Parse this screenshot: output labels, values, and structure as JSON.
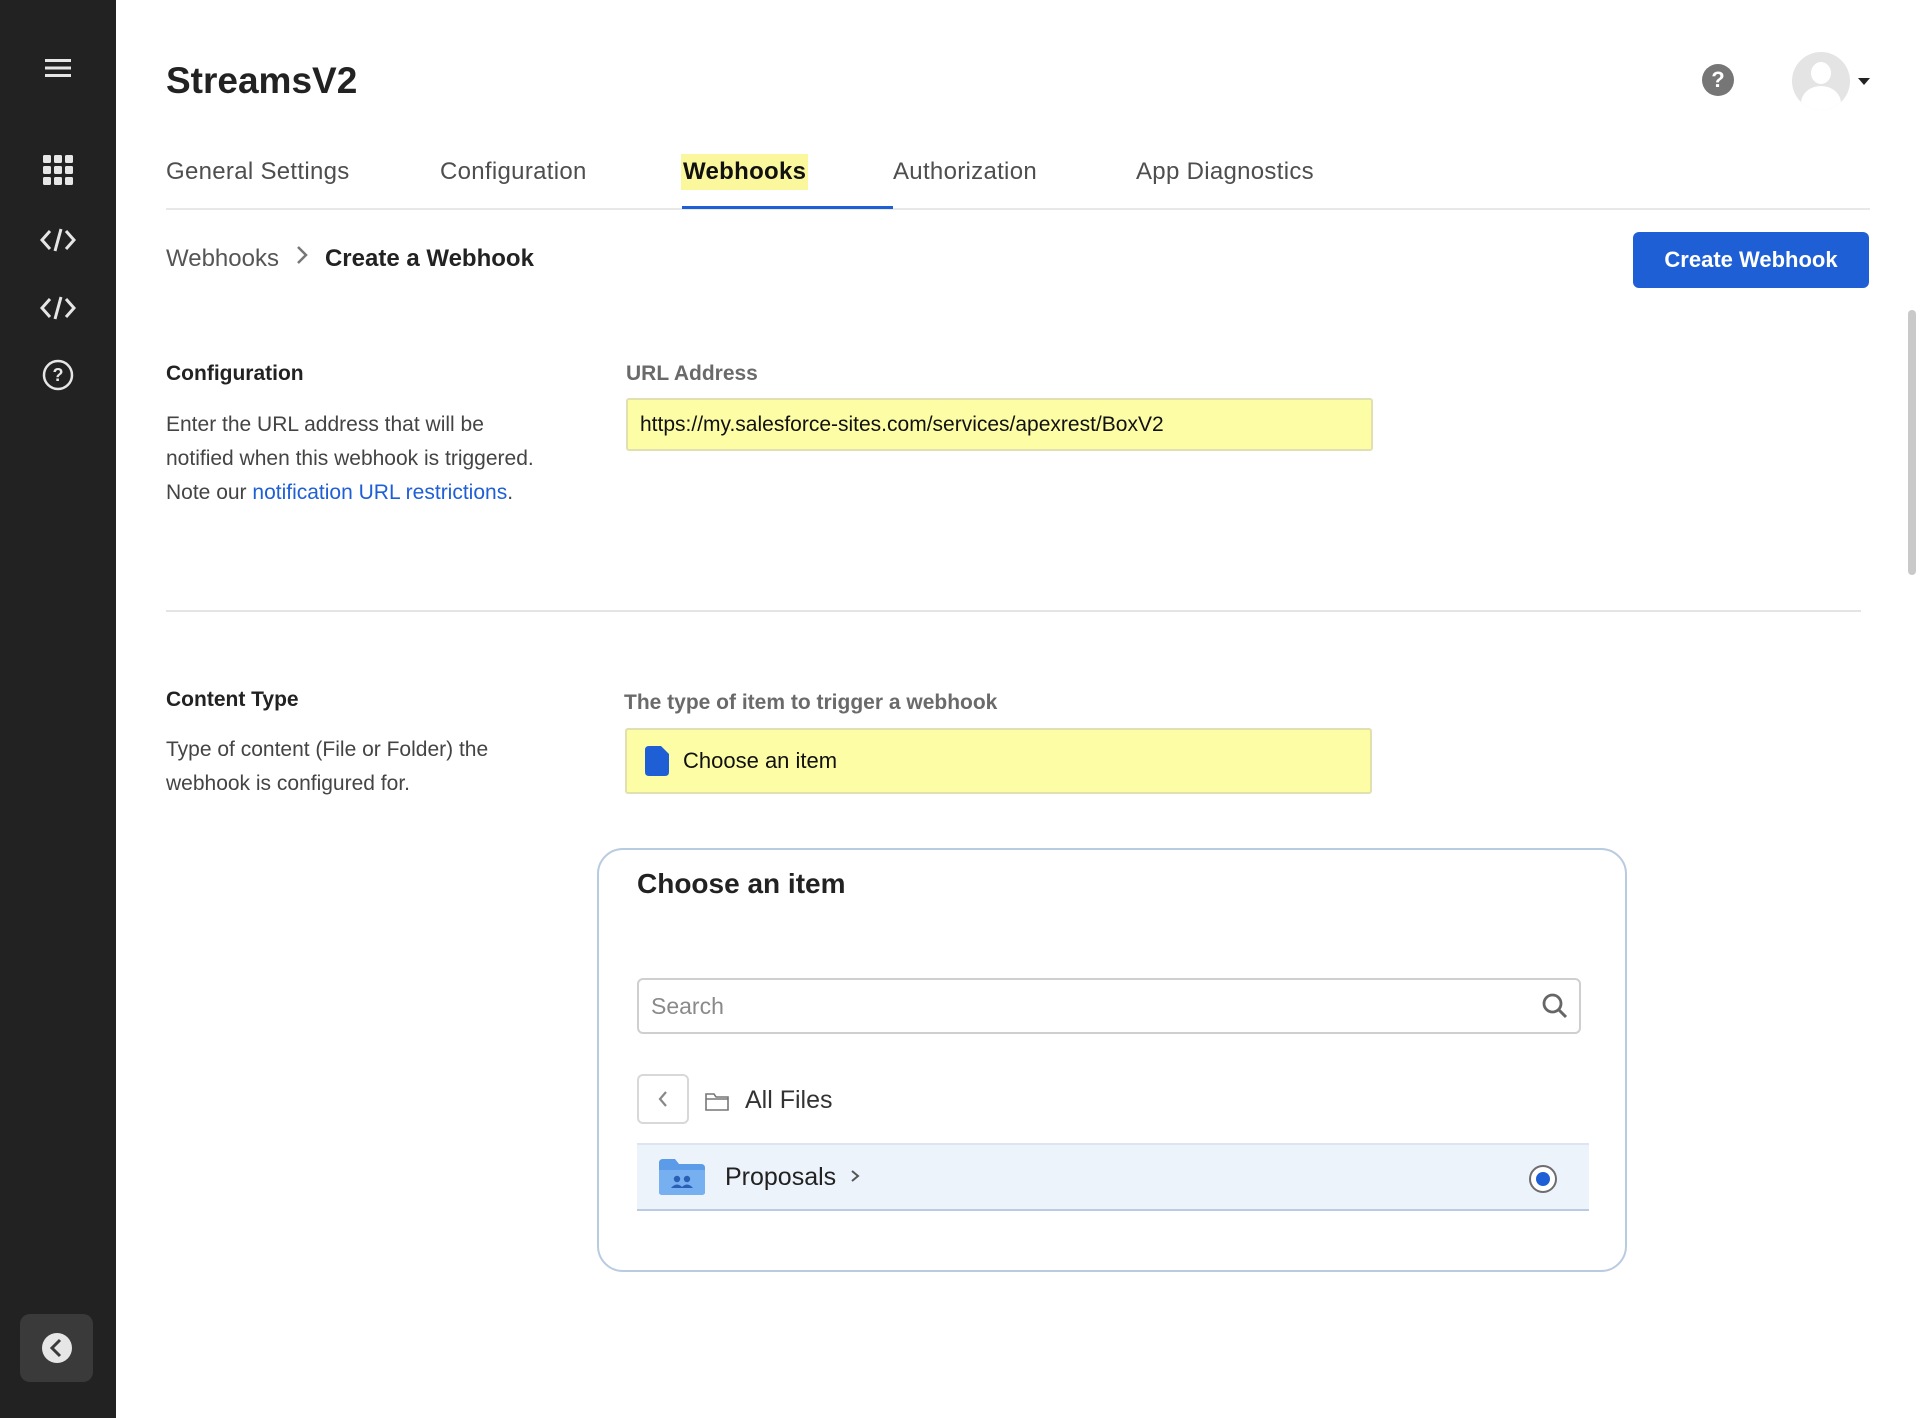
{
  "app": {
    "title": "StreamsV2"
  },
  "tabs": [
    {
      "label": "General Settings"
    },
    {
      "label": "Configuration"
    },
    {
      "label": "Webhooks",
      "active": true
    },
    {
      "label": "Authorization"
    },
    {
      "label": "App Diagnostics"
    }
  ],
  "breadcrumb": {
    "parent": "Webhooks",
    "current": "Create a Webhook"
  },
  "actions": {
    "create_label": "Create Webhook"
  },
  "configuration": {
    "title": "Configuration",
    "desc_before": "Enter the URL address that will be notified when this webhook is triggered. Note our ",
    "desc_link": "notification URL restrictions",
    "desc_after": ".",
    "field_label": "URL Address",
    "url_value": "https://my.salesforce-sites.com/services/apexrest/BoxV2"
  },
  "content_type": {
    "title": "Content Type",
    "desc": "Type of content (File or Folder) the webhook is configured for.",
    "field_label": "The type of item to trigger a webhook",
    "select_value": "Choose an item"
  },
  "picker": {
    "title": "Choose an item",
    "search_placeholder": "Search",
    "location": "All Files",
    "items": [
      {
        "name": "Proposals",
        "selected": true
      }
    ]
  },
  "sidebar": {
    "icons": [
      "hamburger-menu-icon",
      "apps-grid-icon",
      "code-icon",
      "code-icon",
      "help-circle-icon",
      "collapse-chevron-icon"
    ]
  },
  "colors": {
    "accent": "#1f5fd6",
    "highlight": "#fdfda6",
    "sidebar": "#222222"
  }
}
